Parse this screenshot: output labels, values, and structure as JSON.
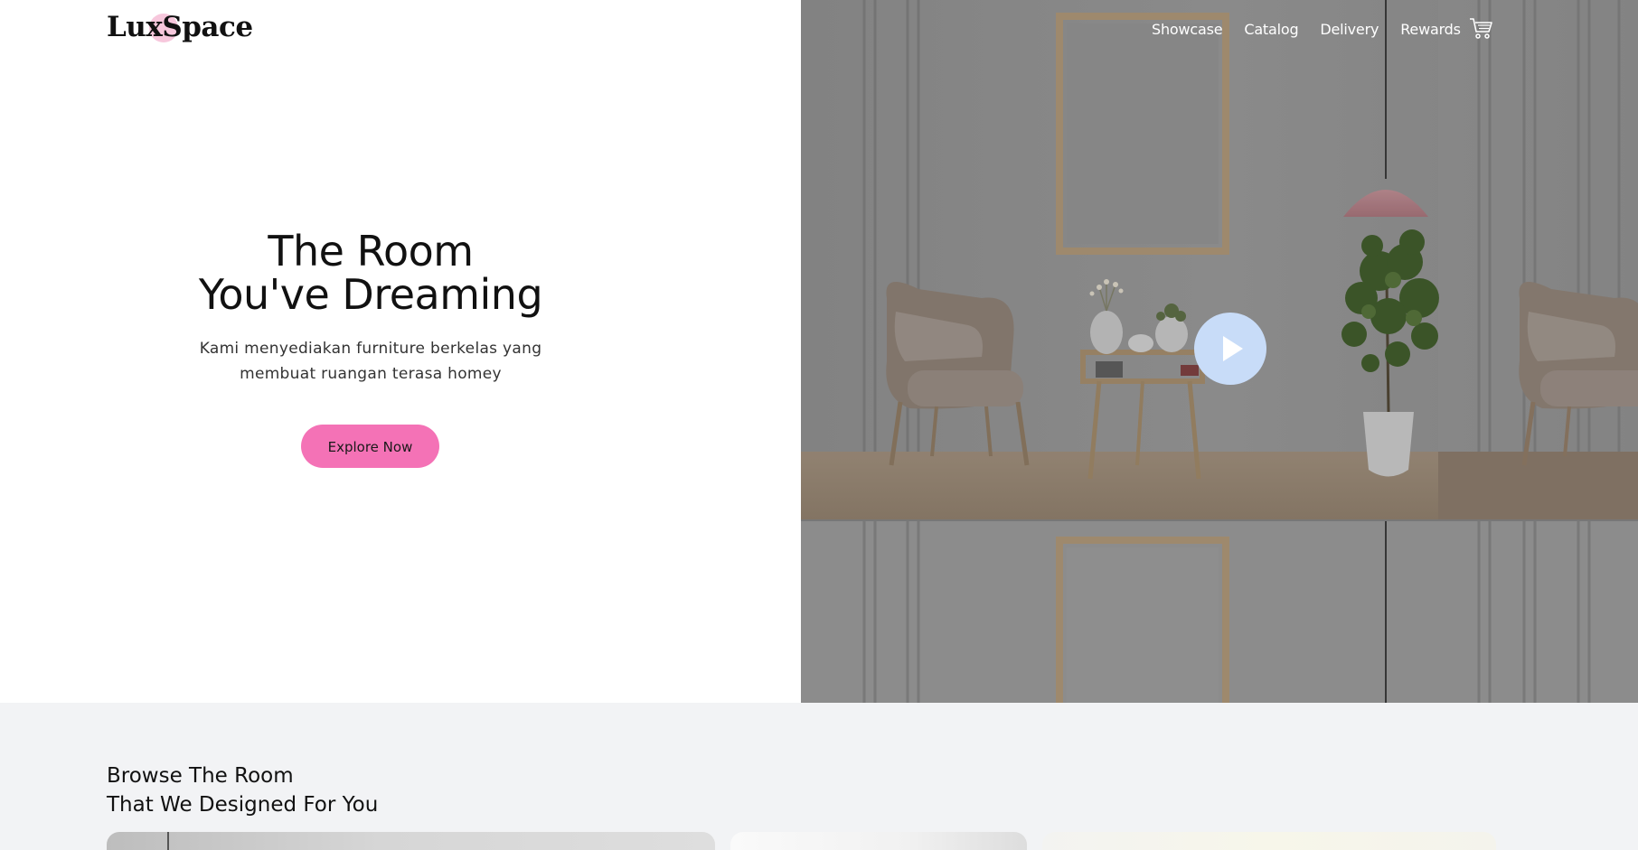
{
  "brand": {
    "logo_text": "LuxSpace",
    "accent_color": "#f472b6",
    "logo_dot_color": "#f7c7dc"
  },
  "nav": {
    "items": [
      {
        "label": "Showcase"
      },
      {
        "label": "Catalog"
      },
      {
        "label": "Delivery"
      },
      {
        "label": "Rewards"
      }
    ],
    "cart_icon": "shopping-cart-icon"
  },
  "hero": {
    "title_line1": "The Room",
    "title_line2": "You've Dreaming",
    "subtitle_line1": "Kami menyediakan furniture berkelas yang",
    "subtitle_line2": "membuat ruangan terasa homey",
    "cta_label": "Explore Now",
    "play_icon": "play-icon",
    "play_color": "#c8dcf8"
  },
  "browse": {
    "title_line1": "Browse The Room",
    "title_line2": "That We Designed For You"
  }
}
